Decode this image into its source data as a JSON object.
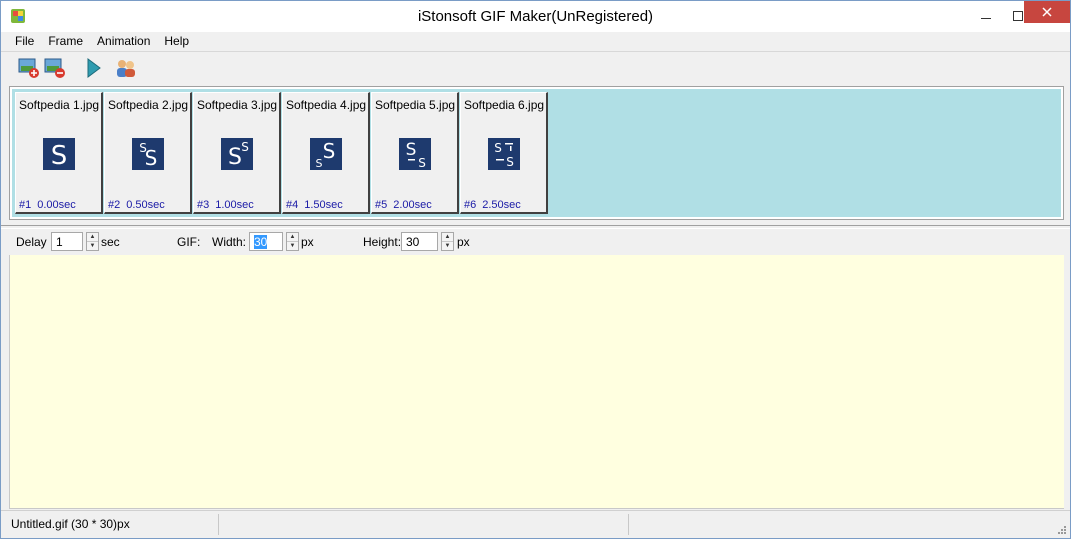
{
  "window": {
    "title": "iStonsoft GIF Maker(UnRegistered)"
  },
  "menu": {
    "items": [
      "File",
      "Frame",
      "Animation",
      "Help"
    ]
  },
  "toolbar": {
    "icons": [
      "add-frame-icon",
      "remove-frame-icon",
      "play-icon",
      "people-icon"
    ]
  },
  "frames": [
    {
      "name": "Softpedia 1.jpg",
      "index": "#1",
      "time": "0.00sec"
    },
    {
      "name": "Softpedia 2.jpg",
      "index": "#2",
      "time": "0.50sec"
    },
    {
      "name": "Softpedia 3.jpg",
      "index": "#3",
      "time": "1.00sec"
    },
    {
      "name": "Softpedia 4.jpg",
      "index": "#4",
      "time": "1.50sec"
    },
    {
      "name": "Softpedia 5.jpg",
      "index": "#5",
      "time": "2.00sec"
    },
    {
      "name": "Softpedia 6.jpg",
      "index": "#6",
      "time": "2.50sec"
    }
  ],
  "settings": {
    "delay_label": "Delay :",
    "delay_value": "1",
    "delay_unit": "sec",
    "gif_label": "GIF:",
    "width_label": "Width:",
    "width_value": "30",
    "width_unit": "px",
    "height_label": "Height:",
    "height_value": "30",
    "height_unit": "px"
  },
  "status": {
    "file": "Untitled.gif (30 * 30)px"
  },
  "colors": {
    "strip_bg": "#b0dfe5",
    "preview_bg": "#ffffe0",
    "thumb_bg": "#1e3a6e",
    "frame_info": "#1a1aa6",
    "close_btn": "#c7463f"
  }
}
